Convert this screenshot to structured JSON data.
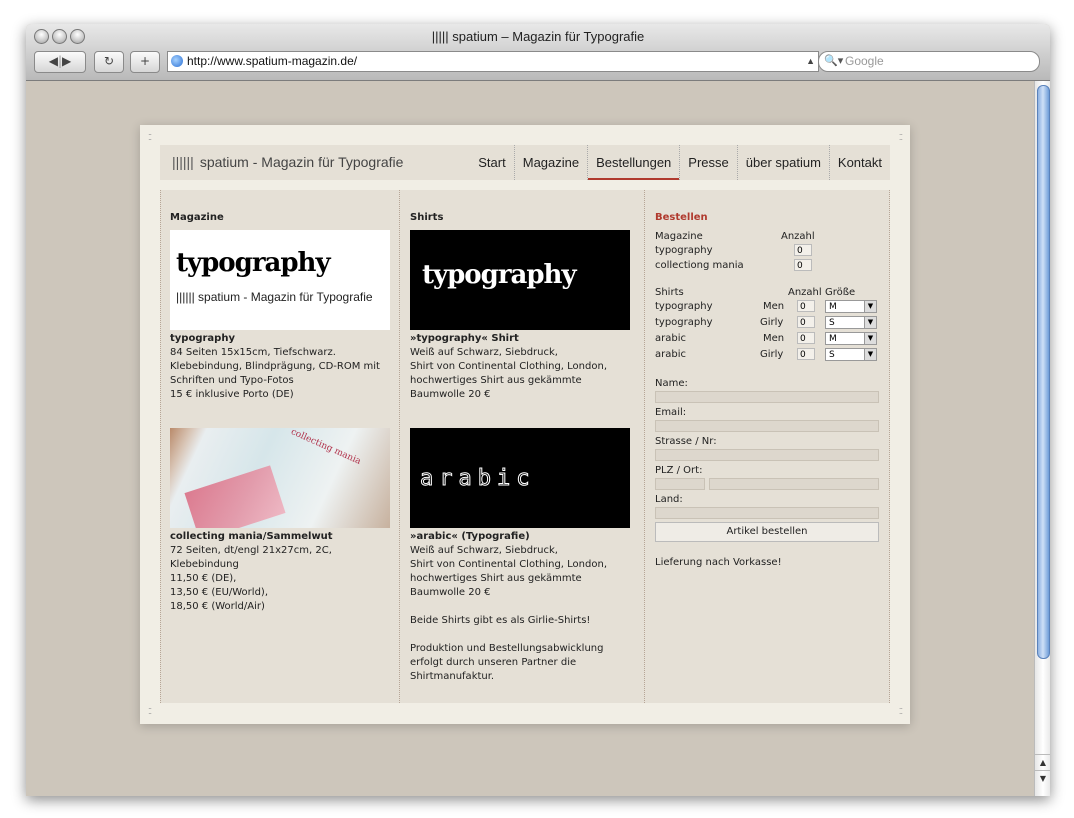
{
  "window": {
    "title": "||||| spatium – Magazin für Typografie",
    "url": "http://www.spatium-magazin.de/",
    "search_placeholder": "Google"
  },
  "site": {
    "logo_bars": "||||||",
    "logo_text": "spatium - Magazin für Typografie",
    "nav": [
      "Start",
      "Magazine",
      "Bestellungen",
      "Presse",
      "über spatium",
      "Kontakt"
    ],
    "active_nav": "Bestellungen"
  },
  "magazine": {
    "heading": "Magazine",
    "items": [
      {
        "image_logo_word": "typography",
        "image_caption_bars": "||||||",
        "image_caption": "spatium - Magazin für Typografie",
        "title": "typography",
        "desc": [
          "84 Seiten 15x15cm, Tiefschwarz.",
          "Klebebindung, Blindprägung, CD-ROM mit",
          "Schriften und Typo-Fotos",
          "15 € inklusive Porto (DE)"
        ]
      },
      {
        "image_word": "collecting mania",
        "title": "collecting mania/Sammelwut",
        "desc": [
          "72 Seiten, dt/engl 21x27cm, 2C,",
          "Klebebindung",
          "11,50 € (DE),",
          "13,50 € (EU/World),",
          "18,50 € (World/Air)"
        ]
      }
    ]
  },
  "shirts": {
    "heading": "Shirts",
    "items": [
      {
        "image_word": "typography",
        "title": "»typography« Shirt",
        "desc": [
          "Weiß auf Schwarz, Siebdruck,",
          "Shirt von Continental Clothing, London,",
          "hochwertiges Shirt aus gekämmte",
          "Baumwolle 20 €"
        ]
      },
      {
        "image_word": "arabic",
        "title": "»arabic« (Typografie)",
        "desc": [
          "Weiß auf Schwarz, Siebdruck,",
          "Shirt von Continental Clothing, London,",
          "hochwertiges Shirt aus gekämmte",
          "Baumwolle 20 €"
        ]
      }
    ],
    "note1": "Beide Shirts gibt es als Girlie-Shirts!",
    "note2": [
      "Produktion und Bestellungsabwicklung",
      "erfolgt durch unseren Partner die",
      "Shirtmanufaktur."
    ]
  },
  "order": {
    "heading": "Bestellen",
    "mag_label": "Magazine",
    "mag_qty_label": "Anzahl",
    "mag_rows": [
      {
        "name": "typography",
        "qty": "0"
      },
      {
        "name": "collectiong mania",
        "qty": "0"
      }
    ],
    "shirts_label": "Shirts",
    "shirts_qty_label": "Anzahl",
    "shirts_size_label": "Größe",
    "shirt_rows": [
      {
        "name": "typography",
        "cut": "Men",
        "qty": "0",
        "size": "M"
      },
      {
        "name": "typography",
        "cut": "Girly",
        "qty": "0",
        "size": "S"
      },
      {
        "name": "arabic",
        "cut": "Men",
        "qty": "0",
        "size": "M"
      },
      {
        "name": "arabic",
        "cut": "Girly",
        "qty": "0",
        "size": "S"
      }
    ],
    "name_label": "Name:",
    "email_label": "Email:",
    "street_label": "Strasse / Nr:",
    "city_label": "PLZ / Ort:",
    "country_label": "Land:",
    "submit_label": "Artikel bestellen",
    "delivery_note": "Lieferung nach Vorkasse!"
  },
  "colors": {
    "accent": "#b03a2e",
    "page_bg": "#f1eee5",
    "panel_bg": "#e5e0d6",
    "desktop_bg": "#cdc6bb"
  }
}
